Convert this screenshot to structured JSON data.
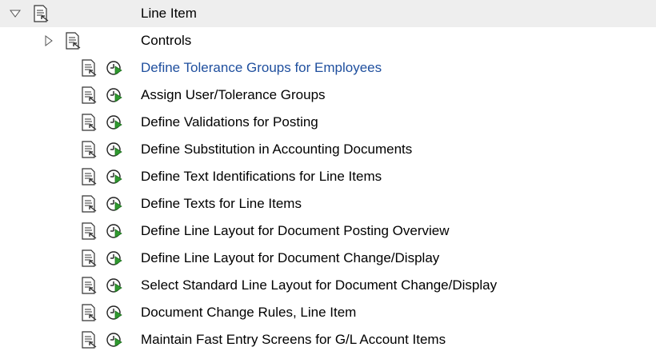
{
  "tree": {
    "root": {
      "label": "Line Item",
      "expanded": true
    },
    "controls": {
      "label": "Controls",
      "expanded": false
    },
    "items": [
      {
        "label": "Define Tolerance Groups for Employees",
        "selected": true
      },
      {
        "label": "Assign User/Tolerance Groups",
        "selected": false
      },
      {
        "label": "Define Validations for Posting",
        "selected": false
      },
      {
        "label": "Define Substitution in Accounting Documents",
        "selected": false
      },
      {
        "label": "Define Text Identifications for Line Items",
        "selected": false
      },
      {
        "label": "Define Texts for Line Items",
        "selected": false
      },
      {
        "label": "Define Line Layout for Document Posting Overview",
        "selected": false
      },
      {
        "label": "Define Line Layout for Document Change/Display",
        "selected": false
      },
      {
        "label": "Select Standard Line Layout for Document Change/Display",
        "selected": false
      },
      {
        "label": "Document Change Rules, Line Item",
        "selected": false
      },
      {
        "label": "Maintain Fast Entry Screens for G/L Account Items",
        "selected": false
      }
    ]
  },
  "icons": {
    "expanded": "triangle-down-icon",
    "collapsed": "triangle-right-icon",
    "document": "img-document-icon",
    "execute": "execute-clock-icon"
  },
  "colors": {
    "selected_text": "#1f4f9e",
    "root_background": "#eeeeee",
    "execute_green": "#2f9a2f"
  }
}
